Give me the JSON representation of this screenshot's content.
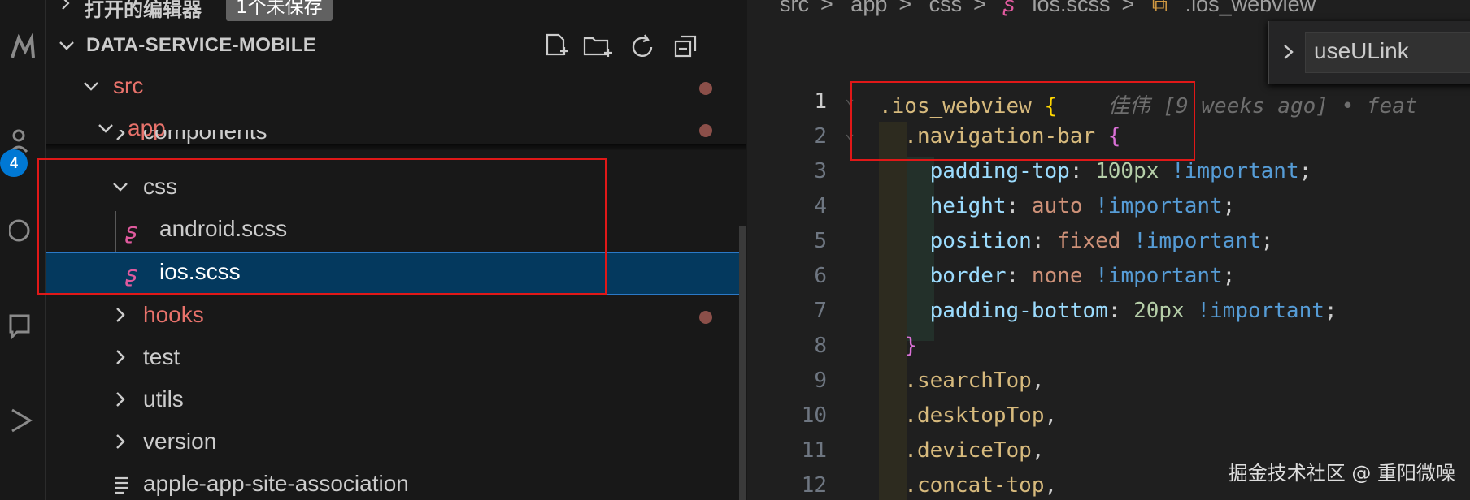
{
  "activity_bar": {
    "icons": [
      "source-control-icon",
      "accounts-icon",
      "search-icon",
      "comments-icon",
      "run-icon"
    ],
    "badge": "4"
  },
  "sidebar": {
    "open_editors_label": "打开的编辑器",
    "unsaved_badge": "1个未保存",
    "project_title": "DATA-SERVICE-MOBILE",
    "toolbar": [
      "new-file-icon",
      "new-folder-icon",
      "refresh-icon",
      "collapse-all-icon"
    ],
    "tree": [
      {
        "label": "src",
        "kind": "folder",
        "expanded": true,
        "modified": true
      },
      {
        "label": "app",
        "kind": "folder",
        "expanded": true,
        "modified": true
      },
      {
        "label": "components",
        "kind": "folder",
        "expanded": false,
        "modified": false
      },
      {
        "label": "css",
        "kind": "folder",
        "expanded": true,
        "modified": false
      },
      {
        "label": "android.scss",
        "kind": "scss",
        "modified": false
      },
      {
        "label": "ios.scss",
        "kind": "scss",
        "selected": true,
        "modified": false
      },
      {
        "label": "hooks",
        "kind": "folder",
        "expanded": false,
        "modified": true
      },
      {
        "label": "test",
        "kind": "folder",
        "expanded": false,
        "modified": false
      },
      {
        "label": "utils",
        "kind": "folder",
        "expanded": false,
        "modified": false
      },
      {
        "label": "version",
        "kind": "folder",
        "expanded": false,
        "modified": false
      },
      {
        "label": "apple-app-site-association",
        "kind": "file",
        "modified": false
      }
    ]
  },
  "editor": {
    "breadcrumb": [
      "src",
      "app",
      "css",
      "ios.scss",
      ".ios_webview"
    ],
    "find_input_value": "useULink",
    "blame": "佳伟 [9 weeks ago] • feat",
    "lines": [
      {
        "n": "1",
        "tokens": [
          [
            ".ios_webview ",
            "sel"
          ],
          [
            "{",
            "brace1"
          ]
        ]
      },
      {
        "n": "2",
        "tokens": [
          [
            "  .navigation-bar ",
            "sel"
          ],
          [
            "{",
            "brace2"
          ]
        ]
      },
      {
        "n": "3",
        "tokens": [
          [
            "    padding-top",
            "prop"
          ],
          [
            ": ",
            "punct"
          ],
          [
            "100px",
            "num"
          ],
          [
            " !important",
            "imp"
          ],
          [
            ";",
            "punct"
          ]
        ]
      },
      {
        "n": "4",
        "tokens": [
          [
            "    height",
            "prop"
          ],
          [
            ": ",
            "punct"
          ],
          [
            "auto",
            "kw"
          ],
          [
            " !important",
            "imp"
          ],
          [
            ";",
            "punct"
          ]
        ]
      },
      {
        "n": "5",
        "tokens": [
          [
            "    position",
            "prop"
          ],
          [
            ": ",
            "punct"
          ],
          [
            "fixed",
            "kw"
          ],
          [
            " !important",
            "imp"
          ],
          [
            ";",
            "punct"
          ]
        ]
      },
      {
        "n": "6",
        "tokens": [
          [
            "    border",
            "prop"
          ],
          [
            ": ",
            "punct"
          ],
          [
            "none",
            "kw"
          ],
          [
            " !important",
            "imp"
          ],
          [
            ";",
            "punct"
          ]
        ]
      },
      {
        "n": "7",
        "tokens": [
          [
            "    padding-bottom",
            "prop"
          ],
          [
            ": ",
            "punct"
          ],
          [
            "20px",
            "num"
          ],
          [
            " !important",
            "imp"
          ],
          [
            ";",
            "punct"
          ]
        ]
      },
      {
        "n": "8",
        "tokens": [
          [
            "  ",
            "punct"
          ],
          [
            "}",
            "brace2"
          ]
        ]
      },
      {
        "n": "9",
        "tokens": [
          [
            "  .searchTop",
            "sel"
          ],
          [
            ",",
            "punct"
          ]
        ]
      },
      {
        "n": "10",
        "tokens": [
          [
            "  .desktopTop",
            "sel"
          ],
          [
            ",",
            "punct"
          ]
        ]
      },
      {
        "n": "11",
        "tokens": [
          [
            "  .deviceTop",
            "sel"
          ],
          [
            ",",
            "punct"
          ]
        ]
      },
      {
        "n": "12",
        "tokens": [
          [
            "  .concat-top",
            "sel"
          ],
          [
            ",",
            "punct"
          ]
        ]
      }
    ]
  },
  "watermark": "掘金技术社区 @ 重阳微噪"
}
